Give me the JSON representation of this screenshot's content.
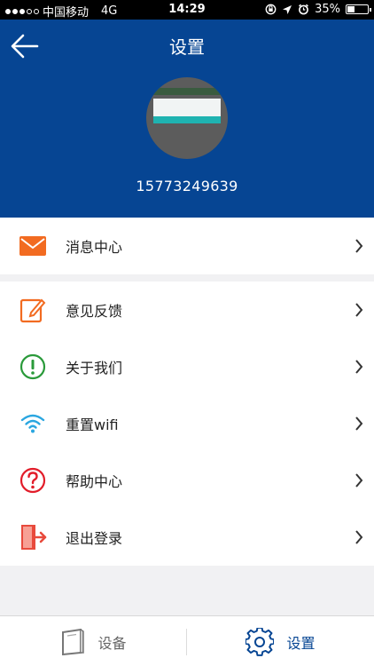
{
  "status_bar": {
    "carrier": "中国移动",
    "network": "4G",
    "time": "14:29",
    "battery": "35%",
    "battery_level": 0.35,
    "signal_strength": 3
  },
  "header": {
    "title": "设置",
    "phone": "15773249639"
  },
  "menu": {
    "group1": [
      {
        "label": "消息中心",
        "icon": "envelope-icon"
      }
    ],
    "group2": [
      {
        "label": "意见反馈",
        "icon": "edit-icon"
      },
      {
        "label": "关于我们",
        "icon": "info-icon"
      },
      {
        "label": "重置wifi",
        "icon": "wifi-icon"
      },
      {
        "label": "帮助中心",
        "icon": "help-icon"
      },
      {
        "label": "退出登录",
        "icon": "logout-icon"
      }
    ]
  },
  "tabbar": {
    "device_label": "设备",
    "settings_label": "设置"
  },
  "colors": {
    "header_bg": "#064593",
    "accent_orange": "#f26b21",
    "info_green": "#2a9a3a",
    "wifi_blue": "#2aa6e0",
    "help_red": "#e21d2a",
    "logout_red": "#e84a3c",
    "active_tab": "#064593",
    "inactive_tab": "#666666"
  }
}
